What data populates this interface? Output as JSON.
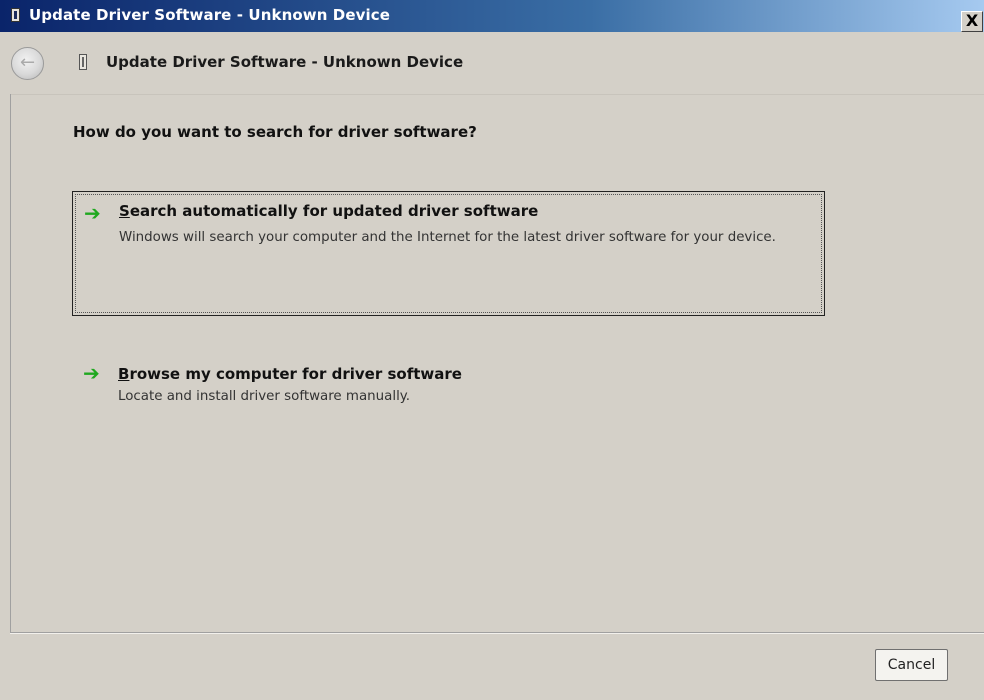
{
  "window": {
    "title": "Update Driver Software - Unknown Device",
    "close_label": "X"
  },
  "header": {
    "back_label": "←",
    "title": "Update Driver Software - Unknown Device"
  },
  "main": {
    "question": "How do you want to search for driver software?",
    "options": [
      {
        "title_accel": "S",
        "title_rest": "earch automatically for updated driver software",
        "description": "Windows will search your computer and the Internet for the latest driver software for your device."
      },
      {
        "title_accel": "B",
        "title_rest": "rowse my computer for driver software",
        "description": "Locate and install driver software manually."
      }
    ]
  },
  "footer": {
    "cancel_label": "Cancel"
  }
}
